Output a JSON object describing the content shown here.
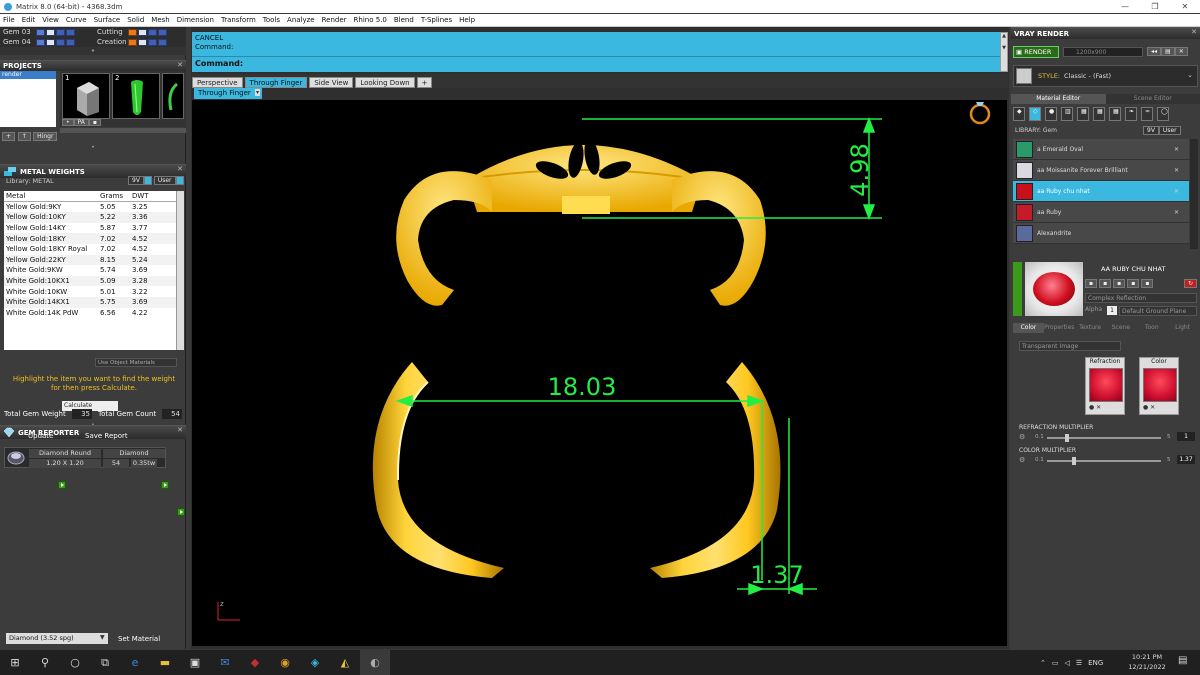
{
  "window": {
    "title": "Matrix 8.0 (64-bit) - 4368.3dm",
    "controls": [
      "—",
      "❐",
      "✕"
    ]
  },
  "menu": [
    "File",
    "Edit",
    "View",
    "Curve",
    "Surface",
    "Solid",
    "Mesh",
    "Dimension",
    "Transform",
    "Tools",
    "Analyze",
    "Render",
    "Rhino 5.0",
    "Blend",
    "T-Splines",
    "Help"
  ],
  "layers": [
    {
      "name": "Gem 03"
    },
    {
      "name": "Gem 04"
    },
    {
      "name": "Cutting"
    },
    {
      "name": "Creation"
    }
  ],
  "projects": {
    "title": "PROJECTS",
    "item": "render",
    "thumbs": [
      {
        "num": "1"
      },
      {
        "num": "2"
      }
    ],
    "buttons": [
      "+",
      "↑",
      "Hingr"
    ]
  },
  "metal_weights": {
    "title": "METAL WEIGHTS",
    "library": "Library: METAL",
    "dropdown": "9V",
    "user": "User",
    "headers": [
      "Metal",
      "Grams",
      "DWT"
    ],
    "rows": [
      [
        "Yellow Gold:9KY",
        "5.05",
        "3.25"
      ],
      [
        "Yellow Gold:10KY",
        "5.22",
        "3.36"
      ],
      [
        "Yellow Gold:14KY",
        "5.87",
        "3.77"
      ],
      [
        "Yellow Gold:18KY",
        "7.02",
        "4.52"
      ],
      [
        "Yellow Gold:18KY Royal",
        "7.02",
        "4.52"
      ],
      [
        "Yellow Gold:22KY",
        "8.15",
        "5.24"
      ],
      [
        "White Gold:9KW",
        "5.74",
        "3.69"
      ],
      [
        "White Gold:10KX1",
        "5.09",
        "3.28"
      ],
      [
        "White Gold:10KW",
        "5.01",
        "3.22"
      ],
      [
        "White Gold:14KX1",
        "5.75",
        "3.69"
      ],
      [
        "White Gold:14K PdW",
        "6.56",
        "4.22"
      ]
    ],
    "use_object": "Use Object Materials",
    "hint": "Highlight the item you want to find the weight for then press Calculate.",
    "calc": "Calculate"
  },
  "gem_reporter": {
    "title": "GEM REPORTER",
    "total_weight_label": "Total Gem Weight",
    "total_weight": "35",
    "total_count_label": "Total Gem Count",
    "total_count": "54",
    "update": "Update",
    "save": "Save Report",
    "gem": {
      "name": "Diamond Round",
      "size": "1.20 X 1.20",
      "type": "Diamond",
      "count": "54",
      "weight": "0.35tw"
    }
  },
  "left_bottom": {
    "material": "Diamond    (3.52 spg)",
    "set": "Set Material"
  },
  "command": {
    "line1": "CANCEL",
    "line2": "Command:",
    "prompt": "Command:"
  },
  "view_tabs": [
    "Perspective",
    "Through Finger",
    "Side View",
    "Looking Down",
    "+"
  ],
  "sub_tab": "Through Finger",
  "dimensions": {
    "height": "4.98",
    "width": "18.03",
    "thickness": "1.37"
  },
  "vray": {
    "title": "VRAY RENDER",
    "render": "RENDER",
    "resolution": "1200x900",
    "style_label": "STYLE:",
    "style": "Classic - (Fast)",
    "tabs": [
      "Material Editor",
      "Scene Editor"
    ],
    "library": "LIBRARY: Gem",
    "materials": [
      {
        "name": "a Emerald Oval",
        "color": "#2a9a6a"
      },
      {
        "name": "aa Moissanite Forever Brilliant",
        "color": "#d8d8e0"
      },
      {
        "name": "aa Ruby chu nhat",
        "color": "#c8101c"
      },
      {
        "name": "aa Ruby",
        "color": "#c41a2a"
      },
      {
        "name": "Alexandrite",
        "color": "#5a6a9a"
      }
    ],
    "selected_name": "AA RUBY CHU NHAT",
    "refl": "Complex Reflection",
    "alpha": "Alpha",
    "alpha_val": "1",
    "ground": "Default Ground Plane",
    "prop_tabs": [
      "Color",
      "Properties",
      "Texture",
      "Scene",
      "Toon",
      "Light"
    ],
    "transparent": "Transparent Image",
    "refraction": "Refraction",
    "color": "Color",
    "refr_mult": "REFRACTION MULTIPLIER",
    "refr_min": "0.1",
    "refr_max": "5",
    "refr_val": "1",
    "color_mult": "COLOR MULTIPLIER",
    "col_min": "0.1",
    "col_max": "5",
    "col_val": "1.37"
  },
  "taskbar": {
    "time": "10:21 PM",
    "date": "12/21/2022",
    "lang": "ENG"
  }
}
